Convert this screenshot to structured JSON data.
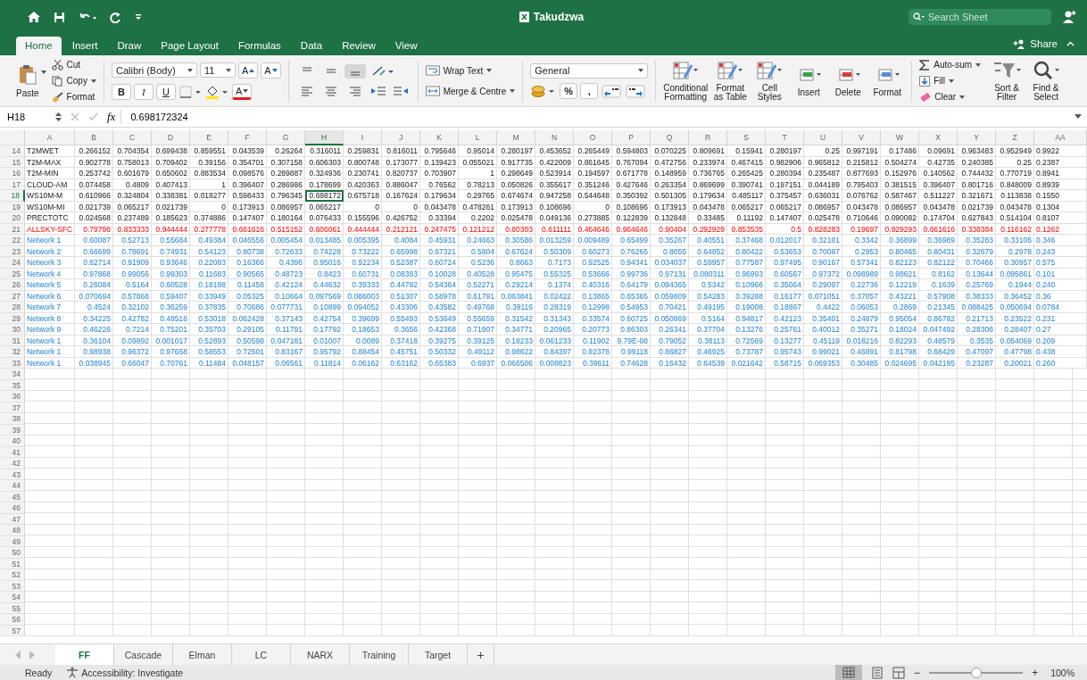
{
  "title_bar": {
    "title": "Takudzwa",
    "search_placeholder": "Search Sheet"
  },
  "ribbon_tabs": [
    {
      "label": "Home",
      "selected": true
    },
    {
      "label": "Insert",
      "selected": false
    },
    {
      "label": "Draw",
      "selected": false
    },
    {
      "label": "Page Layout",
      "selected": false
    },
    {
      "label": "Formulas",
      "selected": false
    },
    {
      "label": "Data",
      "selected": false
    },
    {
      "label": "Review",
      "selected": false
    },
    {
      "label": "View",
      "selected": false
    }
  ],
  "share": "Share",
  "ribbon": {
    "paste": "Paste",
    "cut": "Cut",
    "copy": "Copy",
    "format_painter": "Format",
    "font_name": "Calibri (Body)",
    "font_size": "11",
    "grow_font": "A",
    "shrink_font": "A",
    "style_buttons": [
      "B",
      "I",
      "U"
    ],
    "font_color": "A",
    "wrap_text": "Wrap Text",
    "merge": "Merge & Centre",
    "number_format": "General",
    "number_buttons": [
      "%",
      ","
    ],
    "large_buttons": [
      {
        "kind": "conditional",
        "label": "Conditional\nFormatting"
      },
      {
        "kind": "table",
        "label": "Format\nas Table"
      },
      {
        "kind": "styles",
        "label": "Cell\nStyles"
      },
      {
        "kind": "insert",
        "label": "Insert"
      },
      {
        "kind": "delete",
        "label": "Delete"
      },
      {
        "kind": "format",
        "label": "Format"
      }
    ],
    "autosum": "Auto-sum",
    "fill": "Fill",
    "clear": "Clear",
    "end_buttons": [
      {
        "kind": "sort",
        "label": "Sort &\nFilter"
      },
      {
        "kind": "find",
        "label": "Find &\nSelect"
      }
    ]
  },
  "formula_bar": {
    "cell_ref": "H18",
    "fx": "fx",
    "value": "0.698172324"
  },
  "columns": [
    {
      "label": "A",
      "selected": false
    },
    {
      "label": "B",
      "selected": false
    },
    {
      "label": "C",
      "selected": false
    },
    {
      "label": "D",
      "selected": false
    },
    {
      "label": "E",
      "selected": false
    },
    {
      "label": "F",
      "selected": false
    },
    {
      "label": "G",
      "selected": false
    },
    {
      "label": "H",
      "selected": true
    },
    {
      "label": "I",
      "selected": false
    },
    {
      "label": "J",
      "selected": false
    },
    {
      "label": "K",
      "selected": false
    },
    {
      "label": "L",
      "selected": false
    },
    {
      "label": "M",
      "selected": false
    },
    {
      "label": "N",
      "selected": false
    },
    {
      "label": "O",
      "selected": false
    },
    {
      "label": "P",
      "selected": false
    },
    {
      "label": "Q",
      "selected": false
    },
    {
      "label": "R",
      "selected": false
    },
    {
      "label": "S",
      "selected": false
    },
    {
      "label": "T",
      "selected": false
    },
    {
      "label": "U",
      "selected": false
    },
    {
      "label": "V",
      "selected": false
    },
    {
      "label": "W",
      "selected": false
    },
    {
      "label": "X",
      "selected": false
    },
    {
      "label": "Y",
      "selected": false
    },
    {
      "label": "Z",
      "selected": false
    },
    {
      "label": "AA",
      "selected": false
    }
  ],
  "rows": [
    {
      "num": "14",
      "kind": "input",
      "selected": false,
      "cells": [
        "T2MWET",
        "0.266152",
        "0.704354",
        "0.699438",
        "0.859551",
        "0.043539",
        "0.26264",
        "0.316011",
        "0.259831",
        "0.816011",
        "0.795646",
        "0.95014",
        "0.280197",
        "0.453652",
        "0.265449",
        "0.594803",
        "0.070225",
        "0.809691",
        "0.15941",
        "0.280197",
        "0.25",
        "0.997191",
        "0.17486",
        "0.09691",
        "0.963483",
        "0.952949",
        "0.9922"
      ]
    },
    {
      "num": "15",
      "kind": "input",
      "selected": false,
      "cells": [
        "T2M-MAX",
        "0.902778",
        "0.758013",
        "0.709402",
        "0.39156",
        "0.354701",
        "0.307158",
        "0.606303",
        "0.800748",
        "0.173077",
        "0.139423",
        "0.055021",
        "0.917735",
        "0.422009",
        "0.861645",
        "0.767094",
        "0.472756",
        "0.233974",
        "0.467415",
        "0.982906",
        "0.965812",
        "0.215812",
        "0.504274",
        "0.42735",
        "0.240385",
        "0.25",
        "0.2387"
      ]
    },
    {
      "num": "16",
      "kind": "input",
      "selected": false,
      "cells": [
        "T2M-MIN",
        "0.253742",
        "0.601679",
        "0.650602",
        "0.883534",
        "0.098576",
        "0.289887",
        "0.324936",
        "0.230741",
        "0.820737",
        "0.703907",
        "1",
        "0.298649",
        "0.523914",
        "0.194597",
        "0.671778",
        "0.148959",
        "0.736765",
        "0.265425",
        "0.280394",
        "0.235487",
        "0.877693",
        "0.152976",
        "0.140562",
        "0.744432",
        "0.770719",
        "0.8941"
      ]
    },
    {
      "num": "17",
      "kind": "input",
      "selected": false,
      "cells": [
        "CLOUD-AM",
        "0.074458",
        "0.4809",
        "0.407413",
        "1",
        "0.396407",
        "0.286986",
        "0.178699",
        "0.420363",
        "0.886047",
        "0.76562",
        "0.78213",
        "0.050826",
        "0.355617",
        "0.351246",
        "0.427646",
        "0.263354",
        "0.869699",
        "0.390741",
        "0.197151",
        "0.044189",
        "0.795403",
        "0.381515",
        "0.396407",
        "0.801716",
        "0.848009",
        "0.8939"
      ]
    },
    {
      "num": "18",
      "kind": "input",
      "selected": true,
      "cells": [
        "WS10M-M",
        "0.610966",
        "0.324804",
        "0.338381",
        "0.018277",
        "0.598433",
        "0.796345",
        "0.698172",
        "0.675718",
        "0.167624",
        "0.179634",
        "0.29765",
        "0.674674",
        "0.947258",
        "0.544648",
        "0.350392",
        "0.501305",
        "0.179634",
        "0.485117",
        "0.375457",
        "0.636031",
        "0.076762",
        "0.587467",
        "0.511227",
        "0.321671",
        "0.113838",
        "0.1550"
      ]
    },
    {
      "num": "19",
      "kind": "input",
      "selected": false,
      "cells": [
        "WS10M-MI",
        "0.021739",
        "0.065217",
        "0.021739",
        "0",
        "0.173913",
        "0.086957",
        "0.065217",
        "0",
        "0",
        "0.043478",
        "0.478261",
        "0.173913",
        "0.108696",
        "0",
        "0.108696",
        "0.173913",
        "0.043478",
        "0.065217",
        "0.065217",
        "0.086957",
        "0.043478",
        "0.086957",
        "0.043478",
        "0.021739",
        "0.043478",
        "0.1304"
      ]
    },
    {
      "num": "20",
      "kind": "input",
      "selected": false,
      "cells": [
        "PRECTOTC",
        "0.024568",
        "0.237489",
        "0.185623",
        "0.374886",
        "0.147407",
        "0.180164",
        "0.076433",
        "0.155596",
        "0.426752",
        "0.33394",
        "0.2202",
        "0.025478",
        "0.049136",
        "0.273885",
        "0.122839",
        "0.132848",
        "0.33485",
        "0.11192",
        "0.147407",
        "0.025478",
        "0.710646",
        "0.090082",
        "0.174704",
        "0.627843",
        "0.514104",
        "0.8107"
      ]
    },
    {
      "num": "21",
      "kind": "target",
      "selected": false,
      "cells": [
        "ALLSKY-SFC",
        "0.79798",
        "0.833333",
        "0.944444",
        "0.277778",
        "0.661616",
        "0.515152",
        "0.606061",
        "0.444444",
        "0.212121",
        "0.247475",
        "0.121212",
        "0.80303",
        "0.611111",
        "0.464646",
        "0.964646",
        "0.90404",
        "0.292929",
        "0.853535",
        "0.5",
        "0.828283",
        "0.19697",
        "0.929293",
        "0.661616",
        "0.338384",
        "0.116162",
        "0.1262"
      ]
    },
    {
      "num": "22",
      "kind": "output",
      "selected": false,
      "cells": [
        "Network 1",
        "0.60087",
        "0.52713",
        "0.55684",
        "0.49384",
        "0.046556",
        "0.005454",
        "0.013485",
        "0.005395",
        "0.4084",
        "0.45931",
        "0.24663",
        "0.30586",
        "0.013259",
        "0.009489",
        "0.65499",
        "0.35267",
        "0.40551",
        "0.37468",
        "0.012017",
        "0.32101",
        "0.3342",
        "0.36899",
        "0.36989",
        "0.35283",
        "0.33106",
        "0.346"
      ]
    },
    {
      "num": "23",
      "kind": "output",
      "selected": false,
      "cells": [
        "Network 2",
        "0.66699",
        "0.78691",
        "0.74931",
        "0.54123",
        "0.80738",
        "0.72633",
        "0.74228",
        "0.73222",
        "0.65998",
        "0.67321",
        "0.5804",
        "0.67624",
        "0.50309",
        "0.60273",
        "0.76265",
        "0.8055",
        "0.64852",
        "0.80422",
        "0.53653",
        "0.70087",
        "0.2953",
        "0.80465",
        "0.80431",
        "0.32679",
        "0.2978",
        "0.243"
      ]
    },
    {
      "num": "24",
      "kind": "output",
      "selected": false,
      "cells": [
        "Network 3",
        "0.82714",
        "0.91909",
        "0.93646",
        "0.22083",
        "0.16366",
        "0.4396",
        "0.95016",
        "0.92234",
        "0.52387",
        "0.60724",
        "0.5236",
        "0.8663",
        "0.7173",
        "0.92525",
        "0.94341",
        "0.034037",
        "0.59957",
        "0.77587",
        "0.97495",
        "0.90167",
        "0.57341",
        "0.82123",
        "0.82122",
        "0.70466",
        "0.30957",
        "0.575"
      ]
    },
    {
      "num": "25",
      "kind": "output",
      "selected": false,
      "cells": [
        "Network 4",
        "0.97868",
        "0.99056",
        "0.99303",
        "0.11683",
        "0.90565",
        "0.48723",
        "0.8423",
        "0.60731",
        "0.08393",
        "0.10028",
        "0.40528",
        "0.95475",
        "0.55325",
        "0.53666",
        "0.99736",
        "0.97131",
        "0.080311",
        "0.96993",
        "0.60567",
        "0.97372",
        "0.098989",
        "0.98621",
        "0.8162",
        "0.13644",
        "0.095861",
        "0.101"
      ]
    },
    {
      "num": "26",
      "kind": "output",
      "selected": false,
      "cells": [
        "Network 5",
        "0.26084",
        "0.5164",
        "0.60528",
        "0.18188",
        "0.11458",
        "0.42124",
        "0.44632",
        "0.39333",
        "0.44782",
        "0.54364",
        "0.52271",
        "0.29214",
        "0.1374",
        "0.40316",
        "0.64179",
        "0.094365",
        "0.5342",
        "0.10966",
        "0.35064",
        "0.29097",
        "0.22736",
        "0.12219",
        "0.1639",
        "0.25769",
        "0.1944",
        "0.240"
      ]
    },
    {
      "num": "27",
      "kind": "output",
      "selected": false,
      "cells": [
        "Network 6",
        "0.070694",
        "0.57868",
        "0.59407",
        "0.33949",
        "0.05325",
        "0.10664",
        "0.097569",
        "0.086003",
        "0.51307",
        "0.58978",
        "0.61791",
        "0.063841",
        "0.02422",
        "0.13865",
        "0.65365",
        "0.059809",
        "0.54283",
        "0.39288",
        "0.16177",
        "0.071051",
        "0.37057",
        "0.43221",
        "0.57908",
        "0.38333",
        "0.36452",
        "0.36"
      ]
    },
    {
      "num": "28",
      "kind": "output",
      "selected": false,
      "cells": [
        "Network 7",
        "0.4524",
        "0.32102",
        "0.36259",
        "0.37835",
        "0.70686",
        "0.077731",
        "0.10899",
        "0.094052",
        "0.43306",
        "0.43582",
        "0.49768",
        "0.39116",
        "0.28319",
        "0.12998",
        "0.54953",
        "0.70421",
        "0.49195",
        "0.19008",
        "0.18867",
        "0.4422",
        "0.06053",
        "0.2869",
        "0.21345",
        "0.088425",
        "0.050694",
        "0.0784"
      ]
    },
    {
      "num": "29",
      "kind": "output",
      "selected": false,
      "cells": [
        "Network 8",
        "0.34225",
        "0.42782",
        "0.48516",
        "0.53018",
        "0.062428",
        "0.37143",
        "0.42754",
        "0.39699",
        "0.55493",
        "0.53649",
        "0.55659",
        "0.31542",
        "0.31343",
        "0.33574",
        "0.60725",
        "0.050869",
        "0.5164",
        "0.94817",
        "0.42123",
        "0.35401",
        "0.24879",
        "0.95054",
        "0.86782",
        "0.21713",
        "0.23522",
        "0.231"
      ]
    },
    {
      "num": "30",
      "kind": "output",
      "selected": false,
      "cells": [
        "Network 9",
        "0.46226",
        "0.7214",
        "0.75201",
        "0.35703",
        "0.29105",
        "0.11791",
        "0.17792",
        "0.18653",
        "0.3656",
        "0.42368",
        "0.71907",
        "0.34771",
        "0.20965",
        "0.20773",
        "0.86303",
        "0.26341",
        "0.37704",
        "0.13276",
        "0.25761",
        "0.40012",
        "0.35271",
        "0.18024",
        "0.047492",
        "0.28306",
        "0.28407",
        "0.27"
      ]
    },
    {
      "num": "31",
      "kind": "output",
      "selected": false,
      "cells": [
        "Network 1",
        "0.36104",
        "0.09892",
        "0.001017",
        "0.52893",
        "0.50598",
        "0.047181",
        "0.01007",
        "0.0089",
        "0.37418",
        "0.39275",
        "0.39125",
        "0.18233",
        "0.061233",
        "0.11902",
        "9.79E-08",
        "0.79052",
        "0.38113",
        "0.72569",
        "0.13277",
        "0.45119",
        "0.018216",
        "0.82293",
        "0.48579",
        "0.3535",
        "0.054069",
        "0.209"
      ]
    },
    {
      "num": "32",
      "kind": "output",
      "selected": false,
      "cells": [
        "Network 1",
        "0.98938",
        "0.96372",
        "0.97658",
        "0.58553",
        "0.72501",
        "0.83167",
        "0.95792",
        "0.88454",
        "0.45751",
        "0.50332",
        "0.49112",
        "0.98622",
        "0.84397",
        "0.92378",
        "0.99118",
        "0.86827",
        "0.46925",
        "0.73787",
        "0.95743",
        "0.99021",
        "0.46891",
        "0.81798",
        "0.68429",
        "0.47097",
        "0.47798",
        "0.438"
      ]
    },
    {
      "num": "33",
      "kind": "output",
      "selected": false,
      "cells": [
        "Network 1",
        "0.038945",
        "0.66047",
        "0.70761",
        "0.11484",
        "0.048157",
        "0.06561",
        "0.11814",
        "0.06162",
        "0.63162",
        "0.65383",
        "0.6937",
        "0.066506",
        "0.008823",
        "0.39611",
        "0.74628",
        "0.16432",
        "0.64539",
        "0.021642",
        "0.58715",
        "0.069353",
        "0.30485",
        "0.024695",
        "0.042195",
        "0.23287",
        "0.20021",
        "0.260"
      ]
    }
  ],
  "empty_rows": [
    "34",
    "35",
    "36",
    "37",
    "38",
    "39",
    "40",
    "41",
    "42",
    "43",
    "44",
    "45",
    "46",
    "47",
    "48",
    "49",
    "50",
    "51",
    "52",
    "53",
    "54",
    "55",
    "56",
    "57"
  ],
  "sheet_tabs": [
    {
      "label": "FF",
      "selected": true
    },
    {
      "label": "Cascade",
      "selected": false
    },
    {
      "label": "Elman",
      "selected": false
    },
    {
      "label": "LC",
      "selected": false
    },
    {
      "label": "NARX",
      "selected": false
    },
    {
      "label": "Training",
      "selected": false
    },
    {
      "label": "Target",
      "selected": false
    }
  ],
  "add_sheet": "+",
  "status_bar": {
    "status": "Ready",
    "accessibility": "Accessibility: Investigate",
    "zoom_out": "−",
    "zoom_in": "+",
    "zoom": {
      "level": 0.5
    },
    "zoom_percent": "100%"
  }
}
